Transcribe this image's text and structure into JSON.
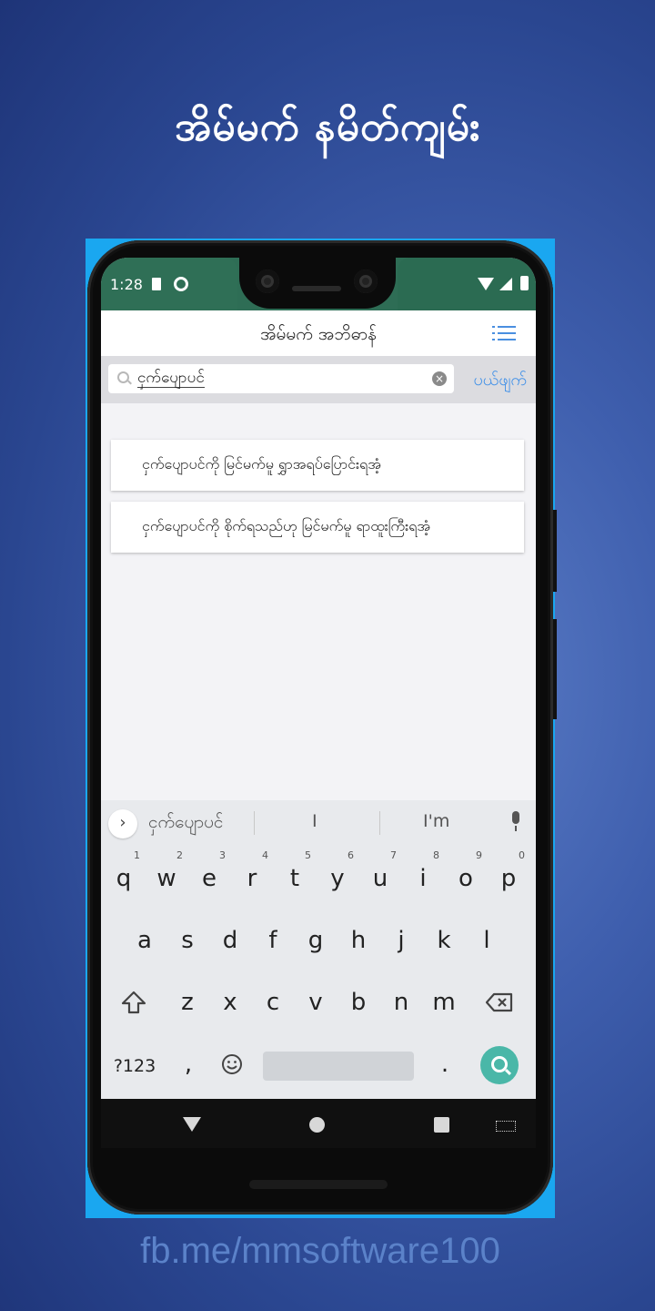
{
  "promo": {
    "title": "အိမ်မက် နမိတ်ကျမ်း",
    "footer_link": "fb.me/mmsoftware100"
  },
  "status_bar": {
    "time": "1:28",
    "icons": [
      "sd-card-icon",
      "sync-icon",
      "wifi-icon",
      "signal-icon",
      "battery-icon"
    ],
    "color": "#2e6d55"
  },
  "app_bar": {
    "title": "အိမ်မက် အဘိဓာန်",
    "menu_icon": "list-menu-icon"
  },
  "search": {
    "value": "ငှက်ပျောပင်",
    "cancel_label": "ပယ်ဖျက်"
  },
  "results": [
    {
      "text": "ငှက်ပျောပင်ကို မြင်မက်မူ ရွှာအရပ်ပြောင်းရအံ့"
    },
    {
      "text": "ငှက်ပျောပင်ကို စိုက်ရသည်ဟု မြင်မက်မူ ရာထူးကြီးရအံ့"
    }
  ],
  "keyboard": {
    "suggestions": [
      "ငှက်ပျောပင်",
      "I",
      "I'm"
    ],
    "row1": [
      {
        "k": "q",
        "n": "1"
      },
      {
        "k": "w",
        "n": "2"
      },
      {
        "k": "e",
        "n": "3"
      },
      {
        "k": "r",
        "n": "4"
      },
      {
        "k": "t",
        "n": "5"
      },
      {
        "k": "y",
        "n": "6"
      },
      {
        "k": "u",
        "n": "7"
      },
      {
        "k": "i",
        "n": "8"
      },
      {
        "k": "o",
        "n": "9"
      },
      {
        "k": "p",
        "n": "0"
      }
    ],
    "row2": [
      "a",
      "s",
      "d",
      "f",
      "g",
      "h",
      "j",
      "k",
      "l"
    ],
    "row3": [
      "z",
      "x",
      "c",
      "v",
      "b",
      "n",
      "m"
    ],
    "symbols_label": "?123",
    "comma": ",",
    "period": ".",
    "accent": "#4ab7a8"
  }
}
